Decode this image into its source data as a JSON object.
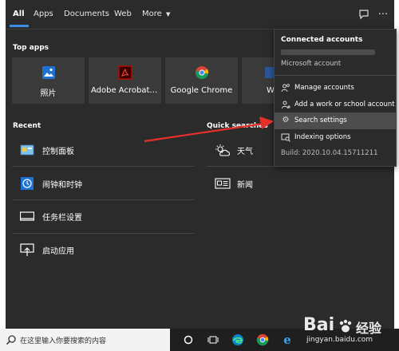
{
  "nav": {
    "tabs": [
      {
        "label": "All",
        "active": true
      },
      {
        "label": "Apps"
      },
      {
        "label": "Documents"
      },
      {
        "label": "Web"
      },
      {
        "label": "More"
      }
    ],
    "feedback_icon": "feedback-icon",
    "more_options_icon": "ellipsis-icon"
  },
  "top_apps": {
    "title": "Top apps",
    "apps": [
      {
        "label": "照片",
        "icon": "photos-icon",
        "color": "#1e73d2"
      },
      {
        "label": "Adobe Acrobat ...",
        "icon": "acrobat-icon",
        "color": "#b30b00"
      },
      {
        "label": "Google Chrome",
        "icon": "chrome-icon"
      },
      {
        "label": "W",
        "icon": "word-icon",
        "color": "#2b579a"
      }
    ]
  },
  "recent": {
    "title": "Recent",
    "items": [
      {
        "label": "控制面板",
        "icon": "control-panel-icon"
      },
      {
        "label": "闹钟和时钟",
        "icon": "alarm-clock-icon"
      },
      {
        "label": "任务栏设置",
        "icon": "taskbar-settings-icon"
      },
      {
        "label": "启动应用",
        "icon": "startup-apps-icon"
      }
    ]
  },
  "quick_searches": {
    "title": "Quick searches",
    "items": [
      {
        "label": "天气",
        "icon": "weather-icon"
      },
      {
        "label": "新闻",
        "icon": "news-icon"
      }
    ]
  },
  "menu": {
    "title": "Connected accounts",
    "account": "Microsoft account",
    "items": [
      {
        "label": "Manage accounts",
        "icon": "manage-accounts-icon"
      },
      {
        "label": "Add a work or school account",
        "icon": "add-account-icon"
      },
      {
        "label": "Search settings",
        "icon": "gear-icon",
        "highlight": true
      },
      {
        "label": "Indexing options",
        "icon": "indexing-icon"
      }
    ],
    "build": "Build: 2020.10.04.15711211"
  },
  "taskbar": {
    "search_placeholder": "在这里输入你要搜索的内容"
  },
  "watermark": {
    "brand": "Bai",
    "brand2": "经验",
    "url": "jingyan.baidu.com"
  },
  "colors": {
    "accent": "#3a8ee6",
    "arrow": "#e8302a"
  }
}
